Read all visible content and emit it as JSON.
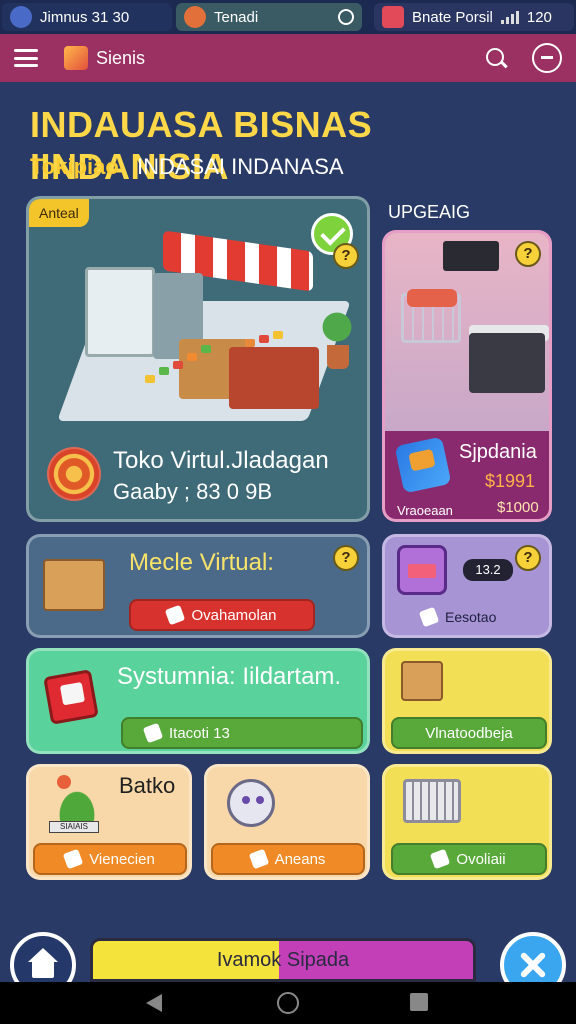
{
  "status_bar": {
    "tab1_label": "Jimnus 31 30",
    "tab2_label": "Tenadi",
    "tab3_label": "Bnate Porsil",
    "time": "120"
  },
  "app_bar": {
    "title": "Sienis"
  },
  "header": {
    "title": "INDAUASA BISNAS IINDANISIA",
    "subtitle_accent": "Tokipiao",
    "subtitle_text": "INDASAI INDANASA"
  },
  "main_card": {
    "tag": "Anteal",
    "shop_name": "Toko Virtul.Jladagan",
    "shop_sub": "Gaaby ; 83 0 9B"
  },
  "upgrade": {
    "label": "UPGEAIG",
    "name": "Sjpdania",
    "price": "$1991",
    "small_label": "Vraoeaan",
    "cost": "$1000"
  },
  "row2": {
    "title": "Mecle Virtual:",
    "button": "Ovahamolan",
    "timer": "13.2",
    "right_label": "Eesotao"
  },
  "row3": {
    "title": "Systumnia: Iildartam.",
    "button": "Itacoti 13",
    "right_button": "Vlnatoodbeja"
  },
  "row4": {
    "a_title": "Batko",
    "a_strip": "SIAIAIS",
    "a_button": "Vienecien",
    "b_button": "Aneans",
    "c_button": "Ovoliaii"
  },
  "bottom": {
    "banner": "Ivamok Sipada"
  },
  "colors": {
    "appbar": "#9b3162",
    "title": "#ffd84a",
    "background": "#2a3a66"
  },
  "icons": [
    "menu-icon",
    "search-icon",
    "chat-icon",
    "check-icon",
    "help-icon",
    "home-icon",
    "close-icon"
  ]
}
